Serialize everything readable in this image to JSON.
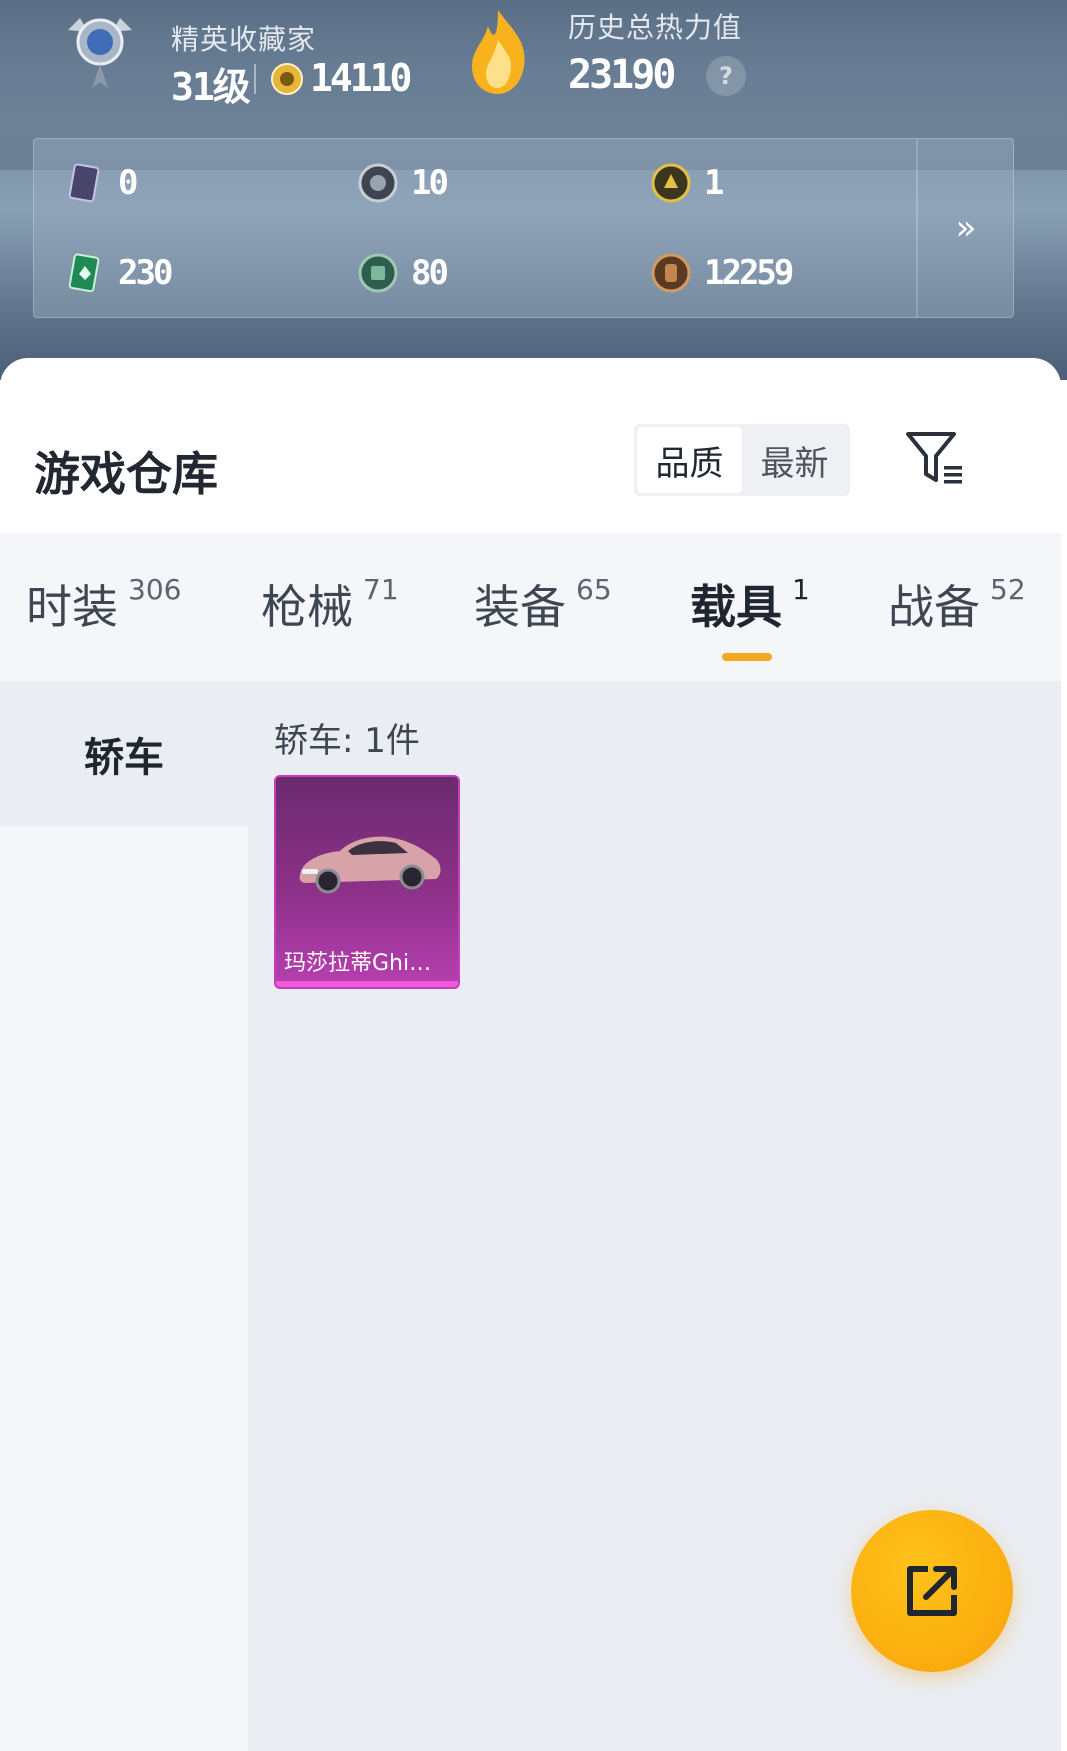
{
  "header": {
    "collector_title": "精英收藏家",
    "level": "31级",
    "points": "14110",
    "heat_title": "历史总热力值",
    "heat_value": "23190",
    "help_glyph": "?"
  },
  "currencies": [
    {
      "icon": "purple-card-icon",
      "value": "0"
    },
    {
      "icon": "silver-coin-icon",
      "value": "10"
    },
    {
      "icon": "gold-token-icon",
      "value": "1"
    },
    {
      "icon": "green-card-icon",
      "value": "230"
    },
    {
      "icon": "jade-coin-icon",
      "value": "80"
    },
    {
      "icon": "bronze-coin-icon",
      "value": "12259"
    }
  ],
  "more_glyph": "»",
  "warehouse": {
    "title": "游戏仓库",
    "sort_options": [
      "品质",
      "最新"
    ],
    "sort_selected": "品质"
  },
  "tabs": [
    {
      "label": "时装",
      "count": "306"
    },
    {
      "label": "枪械",
      "count": "71"
    },
    {
      "label": "装备",
      "count": "65"
    },
    {
      "label": "载具",
      "count": "1",
      "active": true
    },
    {
      "label": "战备",
      "count": "52"
    }
  ],
  "side_nav": {
    "items": [
      {
        "label": "轿车",
        "active": true
      }
    ]
  },
  "group": {
    "title": "轿车: 1件",
    "items": [
      {
        "name": "玛莎拉蒂Ghi…",
        "rarity_color": "#b73fb0"
      }
    ]
  },
  "colors": {
    "accent": "#f5a623",
    "fab": "#fbb010",
    "rarity_purple": "#c53dba"
  }
}
